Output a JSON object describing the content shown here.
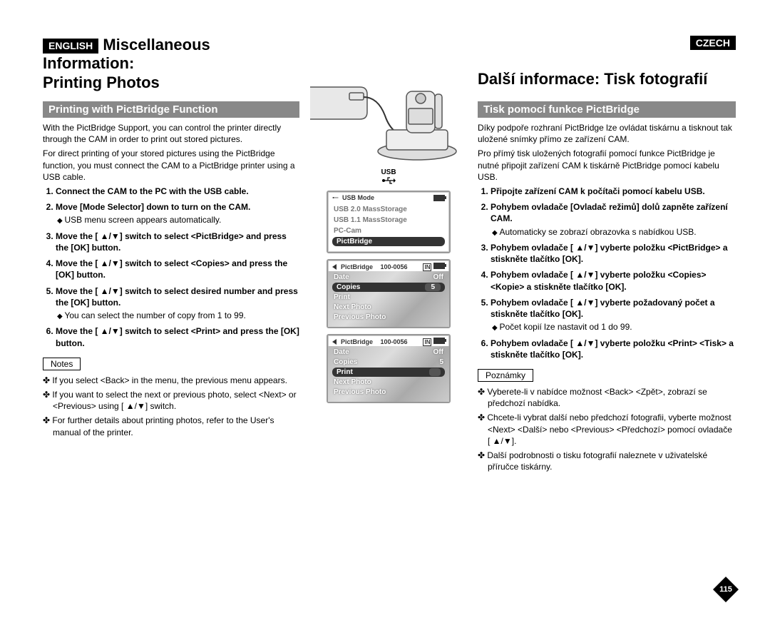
{
  "languages": {
    "left": "ENGLISH",
    "right": "CZECH"
  },
  "left": {
    "title_line1": "Miscellaneous Information:",
    "title_line2": "Printing Photos",
    "section": "Printing with PictBridge Function",
    "intro1": "With the PictBridge Support, you can control the printer directly through the CAM in order to print out stored pictures.",
    "intro2": "For direct printing of your stored pictures using the PictBridge function, you must connect the CAM to a PictBridge printer using a USB cable.",
    "steps": [
      {
        "text": "Connect the CAM to the PC with the USB cable."
      },
      {
        "text": "Move [Mode Selector] down to turn on the CAM.",
        "sub": [
          "USB menu screen appears automatically."
        ]
      },
      {
        "text": "Move the [ ▲/▼] switch to select <PictBridge> and press the [OK] button."
      },
      {
        "text": "Move the [ ▲/▼] switch to select <Copies> and press the [OK] button."
      },
      {
        "text": "Move the [ ▲/▼] switch to select desired number and press the [OK] button.",
        "sub": [
          "You can select the number of copy from 1 to 99."
        ]
      },
      {
        "text": "Move the [ ▲/▼] switch to select <Print> and press the [OK] button."
      }
    ],
    "notes_label": "Notes",
    "notes": [
      "If you select <Back> in the menu, the previous menu appears.",
      "If you want to select the next or previous photo, select <Next> or <Previous> using [ ▲/▼] switch.",
      "For further details about printing photos, refer to the User's manual of the printer."
    ]
  },
  "right": {
    "title": "Další informace: Tisk fotografií",
    "section": "Tisk pomocí funkce PictBridge",
    "intro1": "Díky podpoře rozhraní PictBridge lze ovládat tiskárnu a tisknout tak uložené snímky přímo ze zařízení CAM.",
    "intro2": "Pro přímý tisk uložených fotografií pomocí funkce PictBridge je nutné připojit zařízení CAM k tiskárně PictBridge pomocí kabelu USB.",
    "steps": [
      {
        "text": "Připojte zařízení CAM k počítači pomocí kabelu USB."
      },
      {
        "text": "Pohybem ovladače [Ovladač režimů] dolů zapněte zařízení CAM.",
        "sub": [
          "Automaticky se zobrazí obrazovka s nabídkou USB."
        ]
      },
      {
        "text": "Pohybem ovladače [ ▲/▼] vyberte položku <PictBridge> a stiskněte tlačítko [OK]."
      },
      {
        "text": "Pohybem ovladače [ ▲/▼] vyberte položku <Copies> <Kopie> a stiskněte tlačítko [OK]."
      },
      {
        "text": "Pohybem ovladače [ ▲/▼] vyberte požadovaný počet a stiskněte tlačítko [OK].",
        "sub": [
          "Počet kopií lze nastavit od 1 do 99."
        ]
      },
      {
        "text": "Pohybem ovladače [ ▲/▼] vyberte položku <Print> <Tisk>  a stiskněte tlačítko [OK]."
      }
    ],
    "notes_label": "Poznámky",
    "notes": [
      "Vyberete-li v nabídce možnost <Back> <Zpět>, zobrazí se předchozí nabídka.",
      "Chcete-li vybrat další nebo předchozí fotografii, vyberte možnost <Next> <Další> nebo <Previous> <Předchozí> pomocí ovladače [ ▲/▼].",
      "Další podrobnosti o tisku fotografií naleznete v uživatelské příručce tiskárny."
    ]
  },
  "center": {
    "usb_label": "USB",
    "screen1": {
      "title": "USB Mode",
      "items": [
        "USB 2.0 MassStorage",
        "USB 1.1 MassStorage",
        "PC-Cam",
        "PictBridge"
      ],
      "selected_index": 3
    },
    "screen2": {
      "title": "PictBridge",
      "counter": "100-0056",
      "rows": [
        {
          "label": "Date",
          "value": "Off",
          "light": true
        },
        {
          "label": "Copies",
          "value": "5",
          "selected": true
        },
        {
          "label": "Print",
          "value": "",
          "light": true
        },
        {
          "label": "Next Photo",
          "value": "",
          "light": true
        },
        {
          "label": "Previous Photo",
          "value": "",
          "light": true
        }
      ]
    },
    "screen3": {
      "title": "PictBridge",
      "counter": "100-0056",
      "rows": [
        {
          "label": "Date",
          "value": "Off",
          "light": true
        },
        {
          "label": "Copies",
          "value": "5",
          "light": true
        },
        {
          "label": "Print",
          "value": "",
          "selected": true
        },
        {
          "label": "Next Photo",
          "value": "",
          "light": true
        },
        {
          "label": "Previous Photo",
          "value": "",
          "light": true
        }
      ]
    }
  },
  "page_number": "115"
}
